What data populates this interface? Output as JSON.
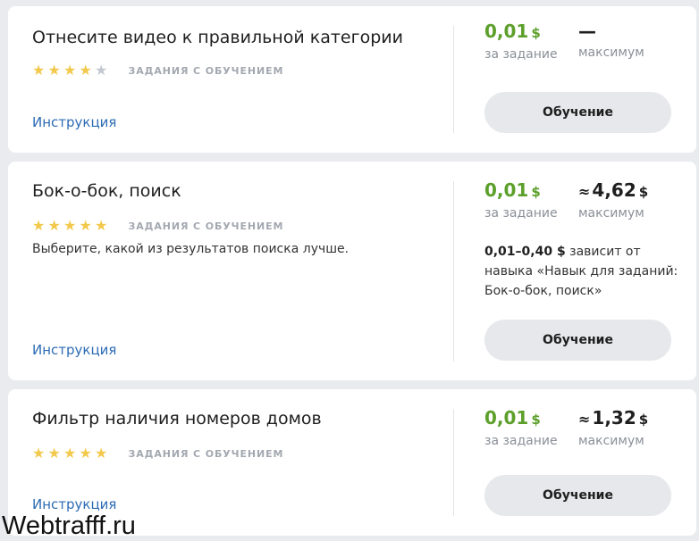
{
  "colors": {
    "accent_green": "#5ca02b",
    "link_blue": "#2d6cb4",
    "star_gold": "#f2c94c",
    "star_empty": "#c3c8d0"
  },
  "common": {
    "badge": "ЗАДАНИЯ С ОБУЧЕНИЕМ",
    "instruction_link": "Инструкция",
    "per_task_label": "за задание",
    "max_label": "максимум",
    "learn_button": "Обучение",
    "currency": "$",
    "approx_sign": "≈"
  },
  "tasks": [
    {
      "title": "Отнесите видео к правильной категории",
      "rating": 4,
      "rating_max": 5,
      "price_per_task": "0,01",
      "max_value": "—"
    },
    {
      "title": "Бок-о-бок, поиск",
      "rating": 5,
      "rating_max": 5,
      "description": "Выберите, какой из результатов поиска лучше.",
      "price_per_task": "0,01",
      "max_value": "4,62",
      "price_range": "0,01–0,40 $",
      "price_range_note": " зависит от навыка «Навык для заданий: Бок-о-бок, поиск»"
    },
    {
      "title": "Фильтр наличия номеров домов",
      "rating": 5,
      "rating_max": 5,
      "price_per_task": "0,01",
      "max_value": "1,32"
    }
  ],
  "watermark": "Webtrafff.ru"
}
